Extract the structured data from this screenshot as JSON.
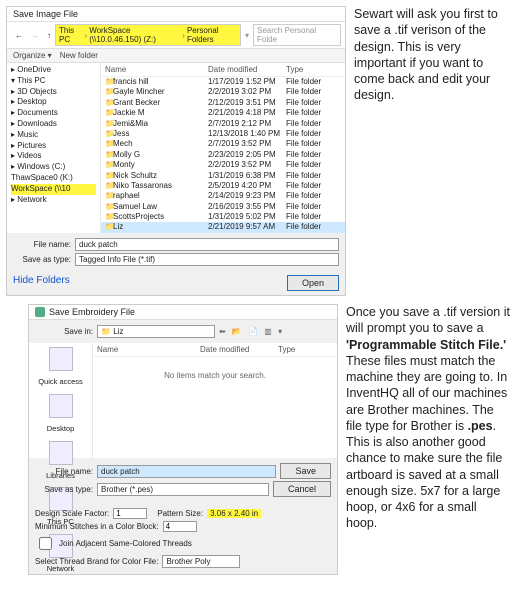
{
  "caption1": "Sewart will ask you first to save a .tif verison of the design. This is very important if you want to come back and edit your design.",
  "caption2_a": "Once you save a .tif version it will prompt you to save a ",
  "caption2_b": "'Programmable Stitch File.'",
  "caption2_c": " These files must match the machine they are going to. In InventHQ all of our machines are Brother machines.  The file type for Brother is ",
  "caption2_d": ".pes",
  "caption2_e": ". This is also another good chance to make sure the file artboard is saved at a small enough size. 5x7 for a large hoop, or 4x6 for a small hoop.",
  "d1": {
    "title": "Save Image File",
    "path": [
      "This PC",
      "WorkSpace (\\\\10.0.46.150) (Z:)",
      "Personal Folders"
    ],
    "search_ph": "Search Personal Folde",
    "organize": "Organize ▾",
    "newfolder": "New folder",
    "cols": {
      "name": "Name",
      "date": "Date modified",
      "type": "Type"
    },
    "side": [
      "▸ OneDrive",
      "▾ This PC",
      "  ▸ 3D Objects",
      "  ▸ Desktop",
      "  ▸ Documents",
      "  ▸ Downloads",
      "  ▸ Music",
      "  ▸ Pictures",
      "  ▸ Videos",
      "▸ Windows (C:)",
      "  ThawSpace0 (K:)",
      "  WorkSpace (\\\\10",
      "▸ Network"
    ],
    "files": [
      {
        "n": "francis hill",
        "d": "1/17/2019 1:52 PM",
        "t": "File folder"
      },
      {
        "n": "Gayle Mincher",
        "d": "2/2/2019 3:02 PM",
        "t": "File folder"
      },
      {
        "n": "Grant Becker",
        "d": "2/12/2019 3:51 PM",
        "t": "File folder"
      },
      {
        "n": "Jackie M",
        "d": "2/21/2019 4:18 PM",
        "t": "File folder"
      },
      {
        "n": "Jemi&Mia",
        "d": "2/7/2019 2:12 PM",
        "t": "File folder"
      },
      {
        "n": "Jess",
        "d": "12/13/2018 1:40 PM",
        "t": "File folder"
      },
      {
        "n": "Mech",
        "d": "2/7/2019 3:52 PM",
        "t": "File folder"
      },
      {
        "n": "Molly G",
        "d": "2/23/2019 2:05 PM",
        "t": "File folder"
      },
      {
        "n": "Monty",
        "d": "2/2/2019 3:52 PM",
        "t": "File folder"
      },
      {
        "n": "Nick Schultz",
        "d": "1/31/2019 6:38 PM",
        "t": "File folder"
      },
      {
        "n": "Niko Tassaronas",
        "d": "2/5/2019 4:20 PM",
        "t": "File folder"
      },
      {
        "n": "raphael",
        "d": "2/14/2019 9:23 PM",
        "t": "File folder"
      },
      {
        "n": "Samuel Law",
        "d": "2/16/2019 3:55 PM",
        "t": "File folder"
      },
      {
        "n": "ScottsProjects",
        "d": "1/31/2019 5:02 PM",
        "t": "File folder"
      },
      {
        "n": "Liz",
        "d": "2/21/2019 9:57 AM",
        "t": "File folder",
        "sel": true
      }
    ],
    "fname_lbl": "File name:",
    "fname": "duck patch",
    "stype_lbl": "Save as type:",
    "stype": "Tagged Info File (*.tif)",
    "hide": "Hide Folders",
    "open": "Open"
  },
  "d2": {
    "title": "Save Embroidery File",
    "savein_lbl": "Save in:",
    "savein": "Liz",
    "cols": {
      "name": "Name",
      "date": "Date modified",
      "type": "Type"
    },
    "empty": "No items match your search.",
    "side": [
      "Quick access",
      "Desktop",
      "Libraries",
      "This PC",
      "Network"
    ],
    "fname_lbl": "File name:",
    "fname": "duck patch",
    "stype_lbl": "Save as type:",
    "stype": "Brother (*.pes)",
    "save": "Save",
    "cancel": "Cancel",
    "dsf_lbl": "Design Scale Factor:",
    "dsf": "1",
    "ps_lbl": "Pattern Size:",
    "ps": "3.06 x 2.40 in",
    "min_lbl": "Minimum Stitches in a Color Block:",
    "min": "4",
    "join": "Join Adjacent Same-Colored Threads",
    "thread_lbl": "Select Thread Brand for Color File:",
    "thread": "Brother Poly"
  }
}
